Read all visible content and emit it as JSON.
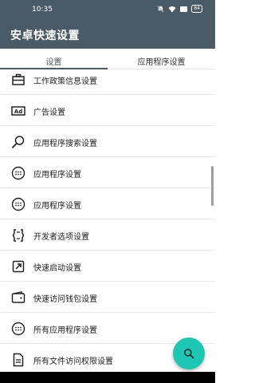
{
  "status_bar": {
    "time": "10:35",
    "battery": "84"
  },
  "app_bar": {
    "title": "安卓快速设置"
  },
  "tabs": [
    {
      "label": "设置",
      "active": true
    },
    {
      "label": "应用程序设置",
      "active": false
    }
  ],
  "list": {
    "items": [
      {
        "label": "工作政策信息设置",
        "icon": "briefcase-icon"
      },
      {
        "label": "广告设置",
        "icon": "ad-icon"
      },
      {
        "label": "应用程序搜索设置",
        "icon": "search-icon"
      },
      {
        "label": "应用程序设置",
        "icon": "apps-circle-icon"
      },
      {
        "label": "应用程序设置",
        "icon": "apps-circle-icon"
      },
      {
        "label": "开发者选项设置",
        "icon": "developer-options-icon"
      },
      {
        "label": "快速启动设置",
        "icon": "quick-launch-icon"
      },
      {
        "label": "快速访问钱包设置",
        "icon": "wallet-icon"
      },
      {
        "label": "所有应用程序设置",
        "icon": "apps-circle-icon"
      },
      {
        "label": "所有文件访问权限设置",
        "icon": "file-icon"
      }
    ]
  },
  "fab": {
    "icon": "search-icon",
    "color": "#1ec7b3"
  },
  "colors": {
    "primary": "#4a5a66",
    "accent": "#1ec7b3"
  }
}
